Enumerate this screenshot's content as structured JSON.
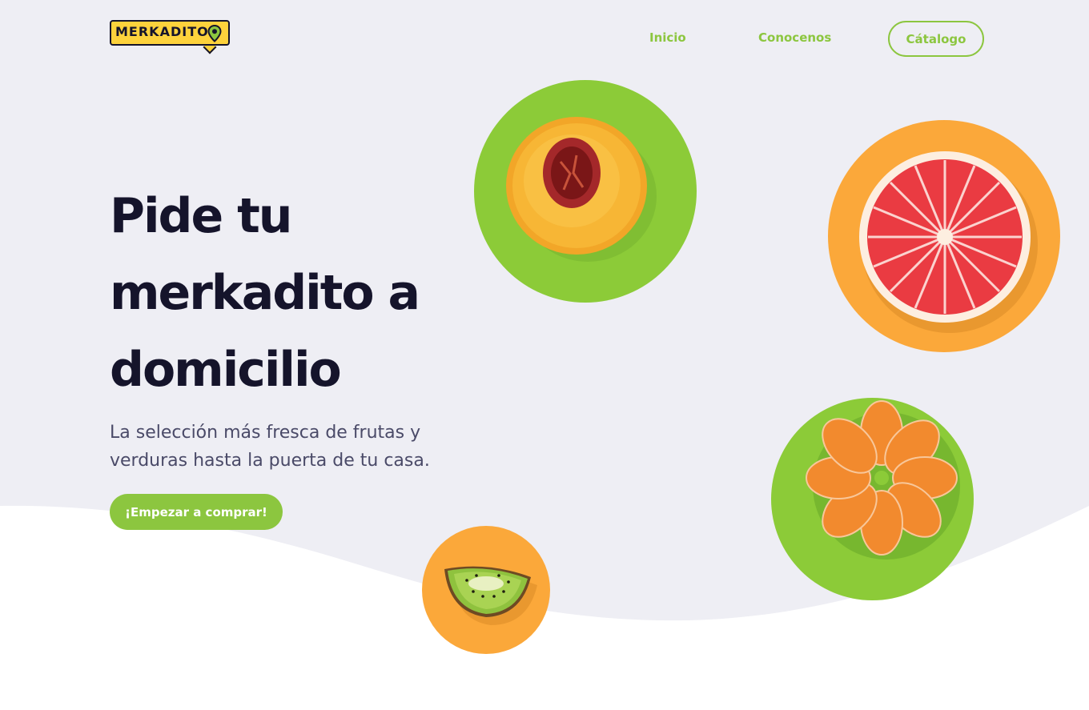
{
  "brand": {
    "logo_text": "MERKADITO"
  },
  "nav": {
    "inicio": "Inicio",
    "conocenos": "Conocenos",
    "catalogo": "Cátalogo"
  },
  "hero": {
    "title": "Pide tu merkadito a domicilio",
    "subtitle": "La selección más fresca de frutas y verduras hasta la puerta de tu casa.",
    "cta": "¡Empezar a comprar!"
  },
  "fruits": [
    {
      "name": "peach",
      "circle_color": "#8ccb38"
    },
    {
      "name": "grapefruit",
      "circle_color": "#fba83a"
    },
    {
      "name": "mandarin",
      "circle_color": "#8ccb38"
    },
    {
      "name": "kiwi",
      "circle_color": "#fba83a"
    }
  ],
  "colors": {
    "accent_green": "#8cc63f",
    "accent_orange": "#fba83a",
    "logo_yellow": "#fdd23c",
    "text_dark": "#15142b",
    "hero_background": "#eeeef4"
  }
}
